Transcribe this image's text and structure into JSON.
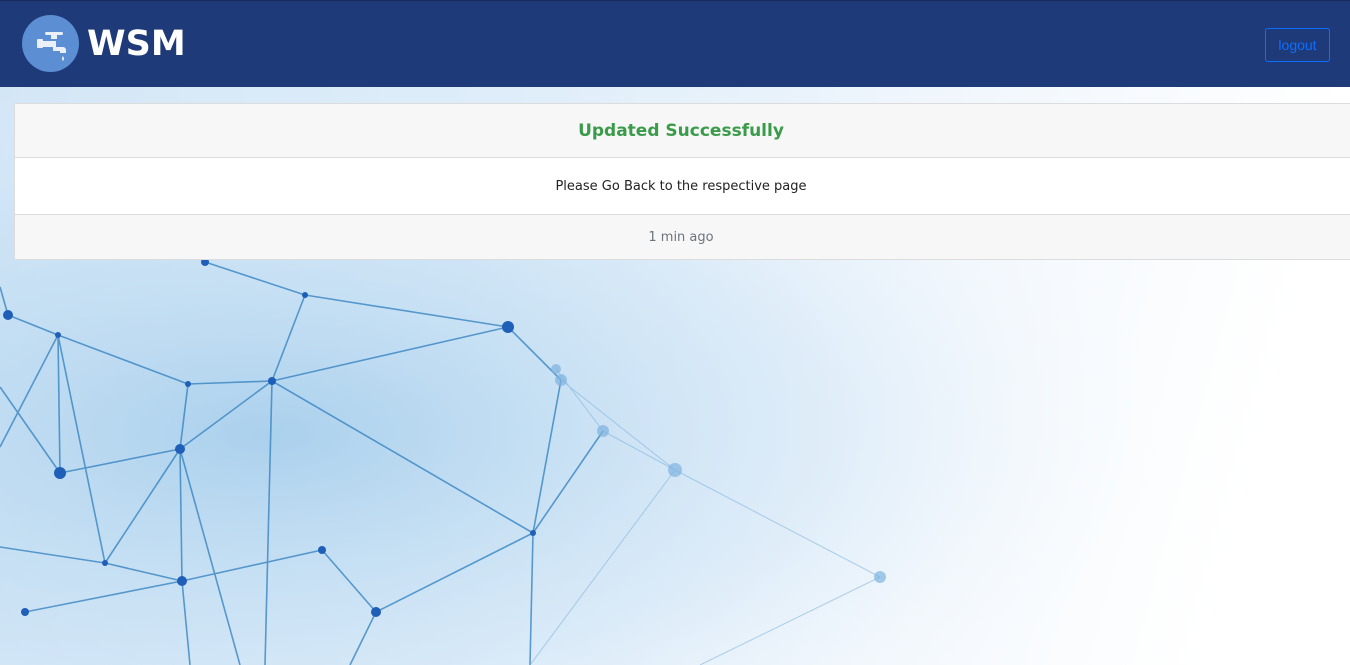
{
  "app": {
    "brand_name": "WSM",
    "logo_icon": "water-tap-icon"
  },
  "navbar": {
    "logout_label": "logout",
    "background_color": "#1f3a78",
    "logout_color": "#0d6efd"
  },
  "message_card": {
    "title": "Updated Successfully",
    "body": "Please Go Back to the respective page",
    "footer": "1 min ago",
    "title_color": "#3a9b4a"
  }
}
